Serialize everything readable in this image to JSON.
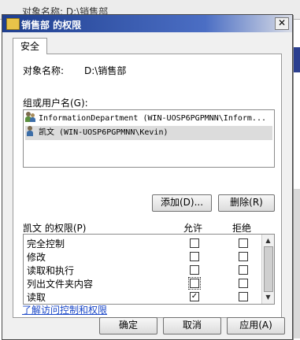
{
  "background": {
    "title_fragment": "对象名称: D:\\销售部"
  },
  "dialog": {
    "title": "销售部 的权限",
    "close_glyph": "✕",
    "tab": "安全",
    "object_name_label": "对象名称:",
    "object_name_value": "D:\\销售部",
    "groups_label": "组或用户名(G):",
    "groups": [
      {
        "name": "InformationDepartment (WIN-UOSP6PGPMNN\\Inform...",
        "icon": "group-icon",
        "selected": false
      },
      {
        "name": "凯文 (WIN-UOSP6PGPMNN\\Kevin)",
        "icon": "user-icon",
        "selected": true
      }
    ],
    "add_button": "添加(D)...",
    "remove_button": "删除(R)",
    "permissions_for": "凯文 的权限(P)",
    "allow_header": "允许",
    "deny_header": "拒绝",
    "permissions": [
      {
        "name": "完全控制",
        "allow": false,
        "deny": false
      },
      {
        "name": "修改",
        "allow": false,
        "deny": false
      },
      {
        "name": "读取和执行",
        "allow": false,
        "deny": false
      },
      {
        "name": "列出文件夹内容",
        "allow": false,
        "deny": false,
        "focused": true
      },
      {
        "name": "读取",
        "allow": true,
        "deny": false
      }
    ],
    "check_glyph": "✓",
    "scroll_up": "▲",
    "scroll_down": "▼",
    "learn_link": "了解访问控制和权限",
    "ok_button": "确定",
    "cancel_button": "取消",
    "apply_button": "应用(A)"
  }
}
